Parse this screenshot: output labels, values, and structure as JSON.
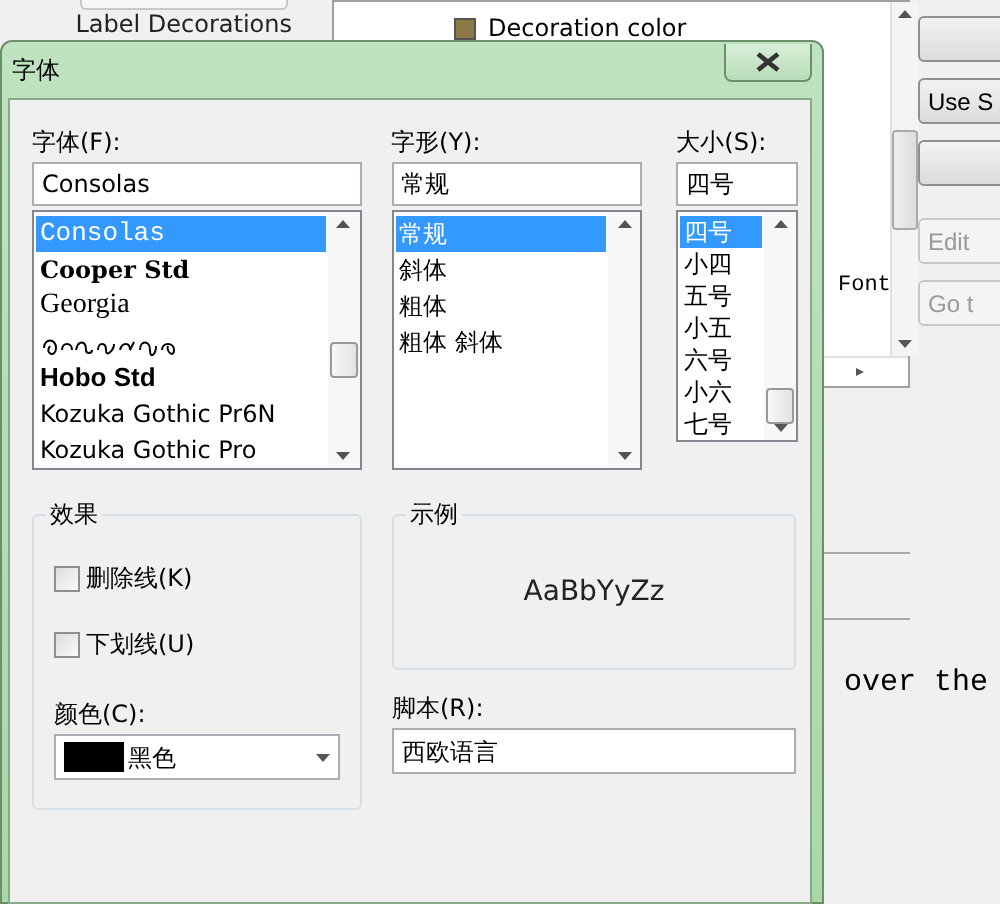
{
  "background_window": {
    "tab_label": "Label Decorations",
    "list_items": [
      {
        "label": "Decoration color",
        "color": "#8b7a45"
      }
    ],
    "list_trailing_text": "Font",
    "side_buttons": [
      {
        "disabled": false
      },
      {
        "label": "Use S",
        "disabled": false
      },
      {
        "disabled": false
      },
      {
        "label": "Edit",
        "disabled": true
      },
      {
        "label": "Go t",
        "disabled": true
      }
    ],
    "preview_text": "over the"
  },
  "dialog": {
    "title": "字体",
    "font": {
      "label": "字体(F):",
      "value": "Consolas",
      "items": [
        {
          "label": "Consolas",
          "kind": "mono",
          "selected": true
        },
        {
          "label": "Cooper Std",
          "kind": "boldserif",
          "selected": false
        },
        {
          "label": "Georgia",
          "kind": "serif",
          "selected": false
        },
        {
          "kind": "glyphs",
          "selected": false
        },
        {
          "label": "Hobo Std",
          "kind": "boldsans",
          "selected": false
        },
        {
          "label": "Kozuka Gothic Pr6N",
          "kind": "sans",
          "selected": false
        },
        {
          "label": "Kozuka Gothic Pro",
          "kind": "sans",
          "selected": false
        }
      ]
    },
    "style": {
      "label": "字形(Y):",
      "value": "常规",
      "items": [
        {
          "label": "常规",
          "selected": true
        },
        {
          "label": "斜体",
          "selected": false
        },
        {
          "label": "粗体",
          "selected": false
        },
        {
          "label": "粗体 斜体",
          "selected": false
        }
      ]
    },
    "size": {
      "label": "大小(S):",
      "value": "四号",
      "items": [
        {
          "label": "四号",
          "selected": true
        },
        {
          "label": "小四",
          "selected": false
        },
        {
          "label": "五号",
          "selected": false
        },
        {
          "label": "小五",
          "selected": false
        },
        {
          "label": "六号",
          "selected": false
        },
        {
          "label": "小六",
          "selected": false
        },
        {
          "label": "七号",
          "selected": false
        }
      ]
    },
    "effects": {
      "title": "效果",
      "checkboxes": [
        {
          "label": "删除线(K)",
          "checked": false
        },
        {
          "label": "下划线(U)",
          "checked": false
        }
      ],
      "color_label": "颜色(C):",
      "color_value": "黑色",
      "color": "#000000"
    },
    "sample": {
      "title": "示例",
      "text": "AaBbYyZz"
    },
    "script": {
      "label": "脚本(R):",
      "value": "西欧语言"
    }
  }
}
